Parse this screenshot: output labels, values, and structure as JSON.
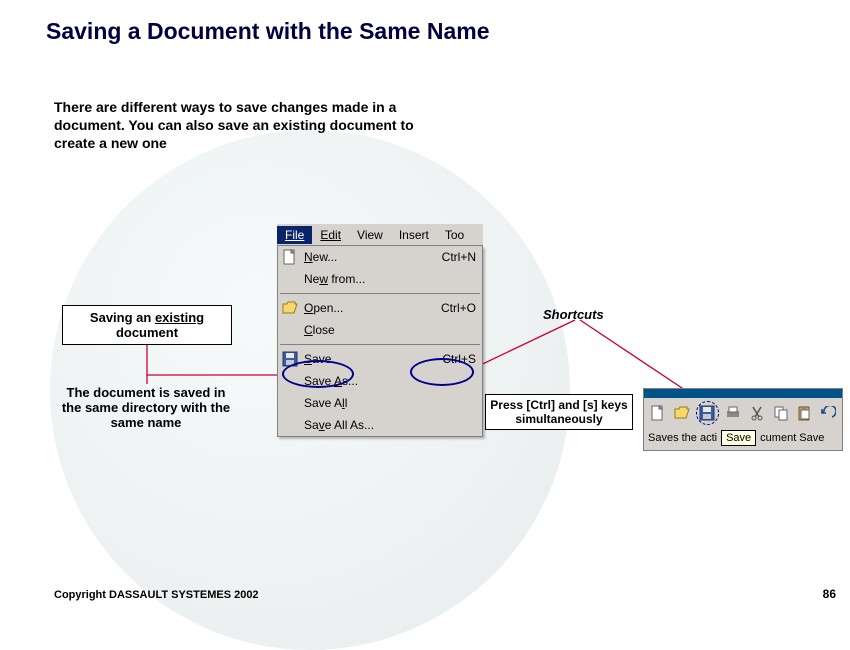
{
  "title": "Saving  a Document with the Same Name",
  "intro": "There are different ways to save changes made in a document. You can also save an existing document to create a new one",
  "annotation_existing_pre": "Saving an ",
  "annotation_existing_u": "existing",
  "annotation_existing_post": " document",
  "annotation_saved": "The document is saved in the same directory with the same name",
  "shortcuts_label": "Shortcuts",
  "press_box": "Press [Ctrl] and [s] keys simultaneously",
  "copyright": "Copyright DASSAULT SYSTEMES 2002",
  "page_number": "86",
  "menubar": {
    "file": "File",
    "edit": "Edit",
    "view": "View",
    "insert": "Insert",
    "tools": "Too"
  },
  "menu": {
    "new": {
      "label_u": "N",
      "label_rest": "ew...",
      "shortcut": "Ctrl+N"
    },
    "newfrom": {
      "label_pre": "Ne",
      "label_u": "w",
      "label_rest": " from..."
    },
    "open": {
      "label_u": "O",
      "label_rest": "pen...",
      "shortcut": "Ctrl+O"
    },
    "close": {
      "label_u": "C",
      "label_rest": "lose"
    },
    "save": {
      "label_u": "S",
      "label_rest": "ave",
      "shortcut": "Ctrl+S"
    },
    "saveas": {
      "label_pre": "Save ",
      "label_u": "A",
      "label_rest": "s..."
    },
    "saveall": {
      "label_pre": "Save A",
      "label_u": "l",
      "label_rest": "l"
    },
    "saveallas": {
      "label_pre": "Sa",
      "label_u": "v",
      "label_rest": "e All As..."
    }
  },
  "toolbar": {
    "tooltip_pre": "Saves the acti",
    "tooltip_box": "Save",
    "tooltip_post": "cument Save",
    "icons": [
      "new-doc-icon",
      "open-folder-icon",
      "save-floppy-icon",
      "print-icon",
      "cut-icon",
      "copy-icon",
      "paste-icon",
      "undo-icon"
    ]
  }
}
